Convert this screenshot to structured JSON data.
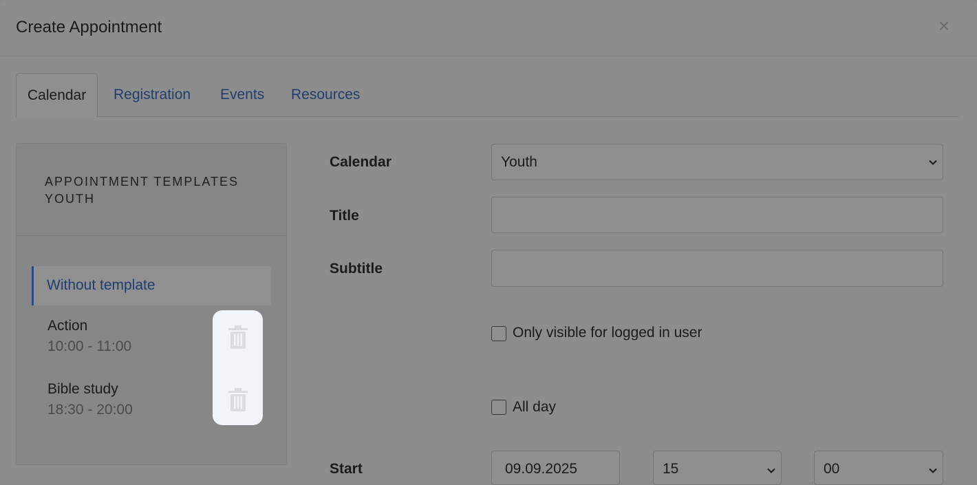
{
  "modal": {
    "title": "Create Appointment",
    "close_label": "×"
  },
  "tabs": [
    {
      "label": "Calendar",
      "active": true
    },
    {
      "label": "Registration",
      "active": false
    },
    {
      "label": "Events",
      "active": false
    },
    {
      "label": "Resources",
      "active": false
    }
  ],
  "templates": {
    "heading": "APPOINTMENT TEMPLATES YOUTH",
    "items": [
      {
        "name": "Without template",
        "time": ""
      },
      {
        "name": "Action",
        "time": "10:00 - 11:00"
      },
      {
        "name": "Bible study",
        "time": "18:30 - 20:00"
      }
    ]
  },
  "form": {
    "calendar_label": "Calendar",
    "calendar_value": "Youth",
    "title_label": "Title",
    "title_value": "",
    "subtitle_label": "Subtitle",
    "subtitle_value": "",
    "only_logged_in_label": "Only visible for logged in user",
    "only_logged_in_checked": false,
    "all_day_label": "All day",
    "all_day_checked": false,
    "start_label": "Start",
    "start_date": "09.09.2025",
    "start_hour": "15",
    "start_minute": "00"
  },
  "icons": {
    "close": "close-icon",
    "trash": "trash-icon",
    "chevron": "chevron-down-icon"
  }
}
